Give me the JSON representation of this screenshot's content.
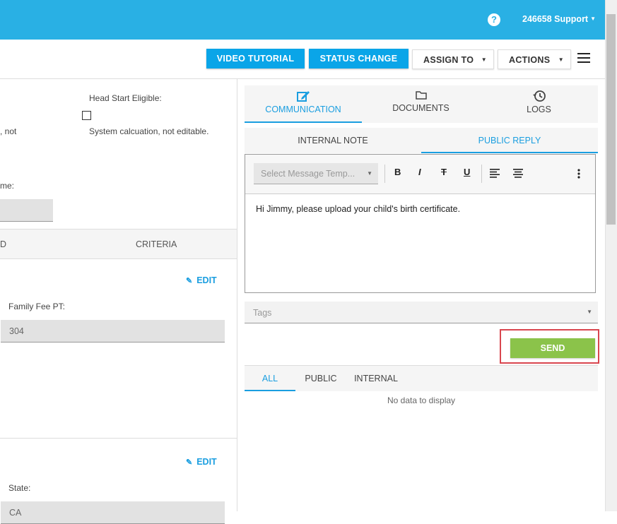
{
  "header": {
    "help_icon_glyph": "?",
    "user_menu": "246658 Support"
  },
  "toolbar": {
    "video_tutorial": "VIDEO TUTORIAL",
    "status_change": "STATUS CHANGE",
    "assign_to": "ASSIGN TO",
    "actions": "ACTIONS"
  },
  "left": {
    "head_start_label": "Head Start Eligible:",
    "head_start_help": "System calcuation, not editable.",
    "partial_not": ", not",
    "partial_me": "me:",
    "table_col_partial": "D",
    "table_col_criteria": "CRITERIA",
    "edit_label": "EDIT",
    "family_fee_label": "Family Fee PT:",
    "family_fee_value": "304",
    "edit_label_2": "EDIT",
    "state_label": "State:",
    "state_value": "CA"
  },
  "right": {
    "tabs": [
      {
        "label": "COMMUNICATION",
        "icon": "edit-icon",
        "active": true
      },
      {
        "label": "DOCUMENTS",
        "icon": "folder-icon",
        "active": false
      },
      {
        "label": "LOGS",
        "icon": "history-icon",
        "active": false
      }
    ],
    "subtabs": [
      {
        "label": "INTERNAL NOTE",
        "active": false
      },
      {
        "label": "PUBLIC REPLY",
        "active": true
      }
    ],
    "template_placeholder": "Select Message Temp...",
    "format_buttons": {
      "bold": "B",
      "italic": "I",
      "strike": "T",
      "underline": "U"
    },
    "message_body": "Hi Jimmy, please upload your child's birth certificate.",
    "tags_placeholder": "Tags",
    "send_label": "SEND",
    "filter_tabs": [
      {
        "label": "ALL",
        "active": true
      },
      {
        "label": "PUBLIC",
        "active": false
      },
      {
        "label": "INTERNAL",
        "active": false
      }
    ],
    "empty_message": "No data to display"
  },
  "colors": {
    "topbar": "#29b0e4",
    "primary_button": "#0aa5e8",
    "accent": "#1a9ee0",
    "send_button": "#8bc34a",
    "highlight_border": "#d9464e"
  }
}
